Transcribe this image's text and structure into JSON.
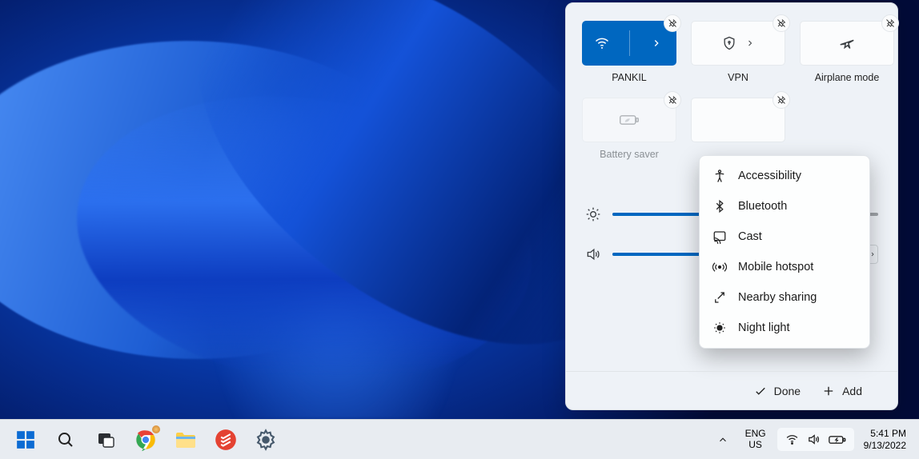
{
  "quick_settings": {
    "tiles": {
      "wifi": {
        "label": "PANKIL",
        "active": true
      },
      "vpn": {
        "label": "VPN"
      },
      "airplane": {
        "label": "Airplane mode"
      },
      "battery_saver": {
        "label": "Battery saver"
      }
    },
    "add_menu": {
      "items": [
        "Accessibility",
        "Bluetooth",
        "Cast",
        "Mobile hotspot",
        "Nearby sharing",
        "Night light"
      ]
    },
    "footer": {
      "done": "Done",
      "add": "Add"
    },
    "brightness_pct": 49,
    "volume_pct": 50
  },
  "taskbar": {
    "language": {
      "line1": "ENG",
      "line2": "US"
    },
    "time": "5:41 PM",
    "date": "9/13/2022"
  }
}
